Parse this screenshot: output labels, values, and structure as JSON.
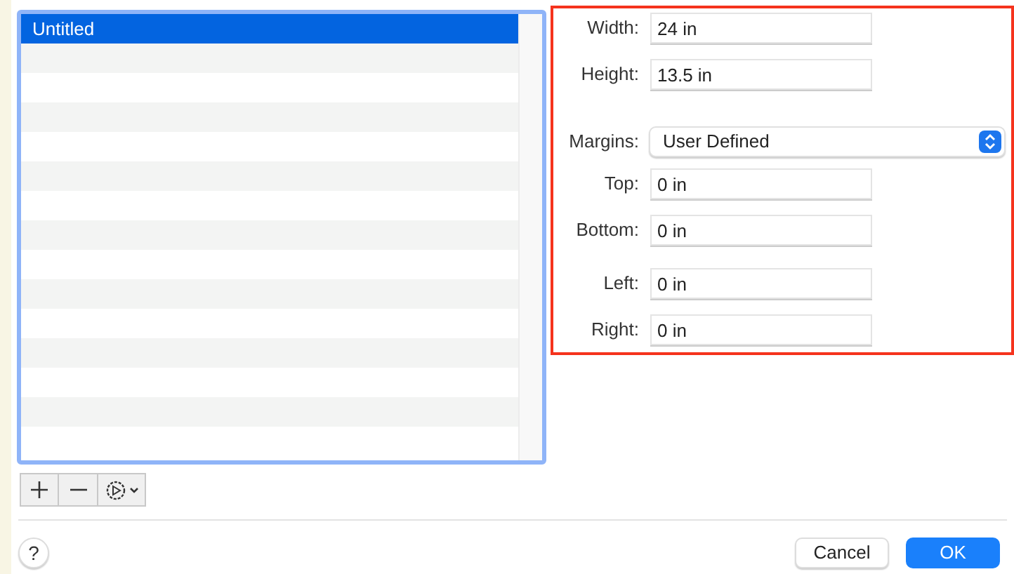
{
  "list": {
    "items": [
      {
        "label": "Untitled",
        "selected": true
      }
    ]
  },
  "size_fields": [
    {
      "label": "Width:",
      "value": "24 in"
    },
    {
      "label": "Height:",
      "value": "13.5 in"
    }
  ],
  "margins": {
    "label": "Margins:",
    "value": "User Defined"
  },
  "margin_fields": [
    {
      "label": "Top:",
      "value": "0 in"
    },
    {
      "label": "Bottom:",
      "value": "0 in"
    },
    {
      "label": "Left:",
      "value": "0 in"
    },
    {
      "label": "Right:",
      "value": "0 in"
    }
  ],
  "buttons": [
    {
      "label": "Cancel",
      "kind": "secondary"
    },
    {
      "label": "OK",
      "kind": "primary"
    }
  ],
  "help": "?"
}
